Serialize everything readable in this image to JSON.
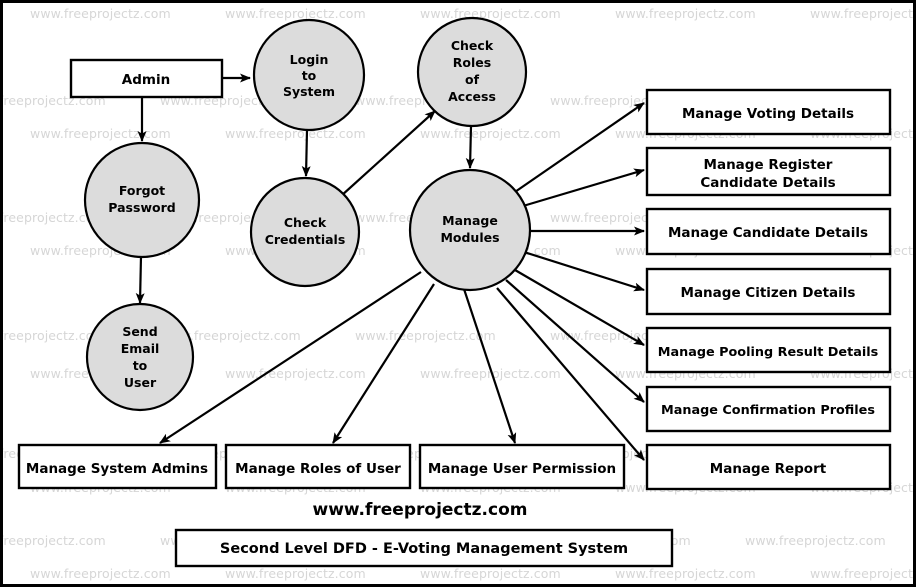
{
  "diagram": {
    "title": "Second Level DFD - E-Voting Management System",
    "brand": "www.freeprojectz.com",
    "watermark": "www.freeprojectz.com",
    "colors": {
      "process_fill": "#dcdcdc",
      "stroke": "#000000",
      "watermark": "#d6d6d6",
      "background": "#ffffff"
    },
    "entities": [
      {
        "id": "admin",
        "label": "Admin",
        "type": "external-entity"
      }
    ],
    "processes": [
      {
        "id": "login_to_system",
        "lines": [
          "Login",
          "to",
          "System"
        ]
      },
      {
        "id": "check_roles",
        "lines": [
          "Check",
          "Roles",
          "of",
          "Access"
        ]
      },
      {
        "id": "forgot_password",
        "lines": [
          "Forgot",
          "Password"
        ]
      },
      {
        "id": "check_credentials",
        "lines": [
          "Check",
          "Credentials"
        ]
      },
      {
        "id": "manage_modules",
        "lines": [
          "Manage",
          "Modules"
        ]
      },
      {
        "id": "send_email",
        "lines": [
          "Send",
          "Email",
          "to",
          "User"
        ]
      }
    ],
    "right_datastores": [
      {
        "id": "voting",
        "lines": [
          "Manage Voting Details"
        ]
      },
      {
        "id": "register_cand",
        "lines": [
          "Manage Register",
          "Candidate Details"
        ]
      },
      {
        "id": "candidate",
        "lines": [
          "Manage Candidate Details"
        ]
      },
      {
        "id": "citizen",
        "lines": [
          "Manage Citizen Details"
        ]
      },
      {
        "id": "pooling",
        "lines": [
          "Manage Pooling Result Details"
        ]
      },
      {
        "id": "confirmation",
        "lines": [
          "Manage Confirmation Profiles"
        ]
      },
      {
        "id": "report",
        "lines": [
          "Manage Report"
        ]
      }
    ],
    "bottom_datastores": [
      {
        "id": "system_admins",
        "label": "Manage System Admins"
      },
      {
        "id": "roles_of_user",
        "label": "Manage Roles of User"
      },
      {
        "id": "user_permission",
        "label": "Manage User Permission"
      }
    ]
  }
}
